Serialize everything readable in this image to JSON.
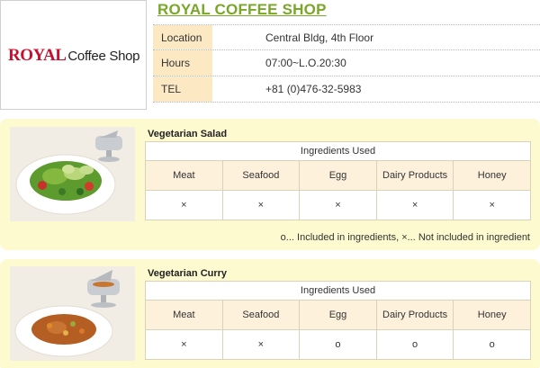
{
  "logo": {
    "brand": "ROYAL",
    "sub": "Coffee Shop"
  },
  "shop": {
    "title": "ROYAL COFFEE SHOP"
  },
  "info": [
    {
      "label": "Location",
      "value": "Central Bldg, 4th Floor"
    },
    {
      "label": "Hours",
      "value": "07:00~L.O.20:30"
    },
    {
      "label": "TEL",
      "value": "+81 (0)476-32-5983"
    }
  ],
  "menu": [
    {
      "title": "Vegetarian Salad",
      "caption": "Ingredients Used",
      "headers": [
        "Meat",
        "Seafood",
        "Egg",
        "Dairy Products",
        "Honey"
      ],
      "values": [
        "×",
        "×",
        "×",
        "×",
        "×"
      ],
      "legend": "o... Included in ingredients, ×... Not included in ingredient"
    },
    {
      "title": "Vegetarian Curry",
      "caption": "Ingredients Used",
      "headers": [
        "Meat",
        "Seafood",
        "Egg",
        "Dairy Products",
        "Honey"
      ],
      "values": [
        "×",
        "×",
        "o",
        "o",
        "o"
      ]
    }
  ]
}
